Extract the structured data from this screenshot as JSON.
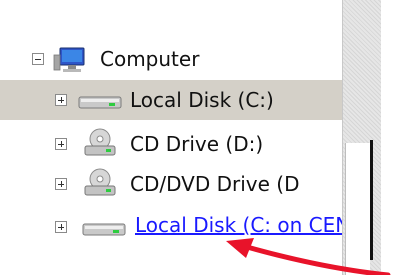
{
  "tree": {
    "root": {
      "label": "Computer",
      "expanded": true,
      "icon": "computer-icon"
    },
    "items": [
      {
        "label": "Local Disk (C:)",
        "icon": "local-disk-icon",
        "selected": true,
        "link": false
      },
      {
        "label": "CD Drive (D:)",
        "icon": "cd-drive-icon",
        "selected": false,
        "link": false
      },
      {
        "label": "CD/DVD Drive (D",
        "icon": "cd-drive-icon",
        "selected": false,
        "link": false
      },
      {
        "label": "Local Disk (C: on CEN",
        "icon": "network-disk-icon",
        "selected": false,
        "link": true
      }
    ]
  },
  "annotation": {
    "type": "red-arrow",
    "color": "#e8132a"
  },
  "colors": {
    "selected_row": "#d4d0c8",
    "link": "#1a1aff"
  }
}
